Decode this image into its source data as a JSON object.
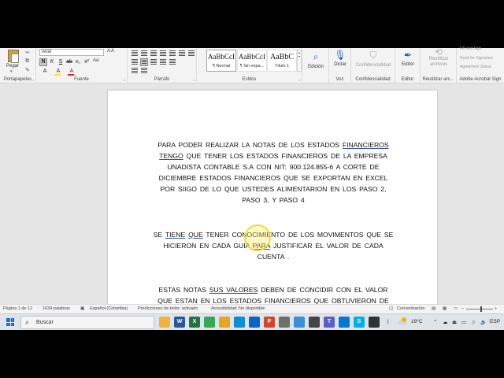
{
  "ribbon": {
    "clipboard": {
      "paste_label": "Pegar",
      "group_label": "Portapapeles"
    },
    "font": {
      "font_name": "Arial",
      "case_label": "Aa",
      "grow_label": "A A",
      "group_label": "Fuente",
      "bold": "N",
      "italic": "K",
      "underline": "S",
      "strike": "ab",
      "subscript": "x₂",
      "superscript": "x²",
      "clear": "A",
      "highlight": "A",
      "font_color": "A",
      "highlight_color": "#ffe600",
      "font_color_value": "#e02020"
    },
    "paragraph": {
      "group_label": "Párrafo"
    },
    "styles": {
      "group_label": "Estilos",
      "items": [
        {
          "preview": "AaBbCcI",
          "name": "¶ Normal"
        },
        {
          "preview": "AaBbCcI",
          "name": "¶ Sin espa..."
        },
        {
          "preview": "AaBbC",
          "name": "Título 1"
        }
      ]
    },
    "editing": {
      "label": "Edición"
    },
    "voice": {
      "dictate_label": "Dictar",
      "group_label": "Voz"
    },
    "sensitivity": {
      "label": "Confidencialidad",
      "group_label": "Confidencialidad"
    },
    "editor": {
      "label": "Editor",
      "group_label": "Editor"
    },
    "reuse": {
      "label": "Reutilizar archivos",
      "group_label": "Reutilizar arc..."
    },
    "acrobat": {
      "items": [
        "Fill and Sign",
        "Send for Signature",
        "Agreement Status"
      ],
      "group_label": "Adobe Acrobat Sign"
    }
  },
  "document": {
    "paragraph1": [
      [
        "PARA PODER REALIZAR   LA NOTAS DE LOS ESTADOS ",
        {
          "u": "FINANCIEROS"
        }
      ],
      [
        {
          "u": "TENGO"
        },
        " QUE TENER   LOS ESTADOS FINANCIEROS DE  LA EMPRESA"
      ],
      [
        "UNADISTA CONTABLE S.A CON NIT: 900.124.855-6  A CORTE DE"
      ],
      [
        "DICIEMBRE   ESTADOS FINANCIEROS  QUE SE EXPORTAN   EN EXCEL"
      ],
      [
        "POR  SIIGO  DE  LO QUE USTEDES  ALIMENTARION   EN LOS PASO 2,"
      ],
      [
        "PASO 3, Y PASO 4"
      ]
    ],
    "paragraph2": [
      [
        "SE ",
        {
          "u": "TIENE"
        },
        "  ",
        {
          "u": "QUE"
        },
        " TENER   CONOCIMIENTO DE  LOS  MOVIMENTOS QUE SE"
      ],
      [
        "HICIERON  EN CADA  GUIA   ",
        {
          "u": "PARA"
        },
        " JUSTIFICAR EL VALOR  DE    CADA"
      ],
      [
        "CUENTA ."
      ]
    ],
    "paragraph3": [
      [
        "ESTAS   NOTAS ",
        {
          "u": "SUS VALORES"
        },
        "  DEBEN  DE CONCIDIR  CON EL VALOR"
      ],
      [
        "QUE ESTAN EN  LOS  ESTADOS   FINANCIEROS  QUE  OBTUVIERON DE"
      ]
    ]
  },
  "statusbar": {
    "page": "Página 1 de 12",
    "words": "1634 palabras",
    "language": "Español (Colombia)",
    "predictions": "Predicciones de texto: activado",
    "accessibility": "Accesibilidad: No disponible",
    "focus": "Concentración"
  },
  "taskbar": {
    "search_label": "Buscar",
    "temperature": "19°C",
    "language": "ESP",
    "apps": [
      {
        "name": "file-explorer",
        "color": "#f2b33d",
        "glyph": ""
      },
      {
        "name": "word",
        "color": "#2b579a",
        "glyph": "W"
      },
      {
        "name": "excel",
        "color": "#217346",
        "glyph": "X"
      },
      {
        "name": "chrome",
        "color": "#34a853",
        "glyph": ""
      },
      {
        "name": "explorer-folder",
        "color": "#e7a520",
        "glyph": ""
      },
      {
        "name": "edge",
        "color": "#0f8bd8",
        "glyph": ""
      },
      {
        "name": "mail",
        "color": "#0a64c8",
        "glyph": ""
      },
      {
        "name": "powerpoint",
        "color": "#d24726",
        "glyph": "P"
      },
      {
        "name": "snipping-tool",
        "color": "#6e6e6e",
        "glyph": ""
      },
      {
        "name": "photos",
        "color": "#3a8fd9",
        "glyph": ""
      },
      {
        "name": "calculator",
        "color": "#444444",
        "glyph": ""
      },
      {
        "name": "teams",
        "color": "#5b5fc7",
        "glyph": "T"
      },
      {
        "name": "store",
        "color": "#0078d4",
        "glyph": ""
      },
      {
        "name": "skype",
        "color": "#00aff0",
        "glyph": "S"
      },
      {
        "name": "media-app",
        "color": "#333333",
        "glyph": ""
      }
    ]
  }
}
